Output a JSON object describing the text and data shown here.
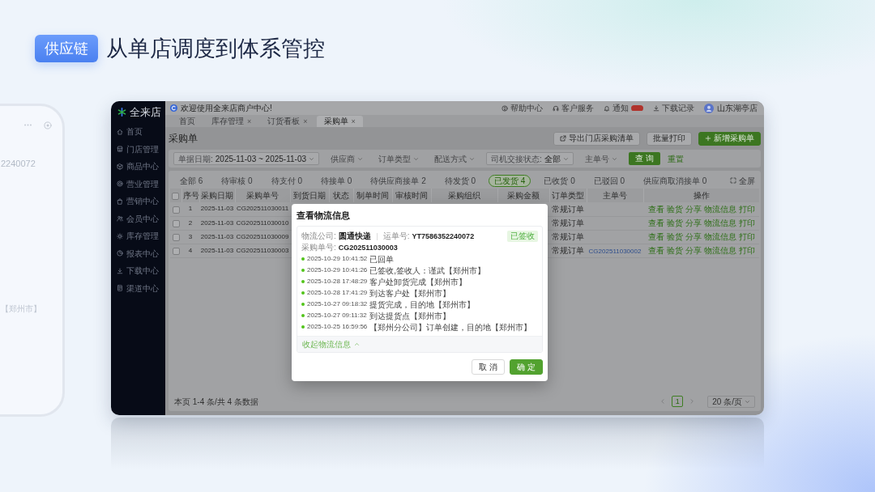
{
  "slide": {
    "tag": "供应链",
    "headline": "从单店调度到体系管控"
  },
  "phone": {
    "texts": [
      "2240072",
      "【郑州市】"
    ]
  },
  "app": {
    "logo": "全来店",
    "sidebar": [
      {
        "label": "首页",
        "selected": false
      },
      {
        "label": "门店管理",
        "selected": false
      },
      {
        "label": "商品中心",
        "selected": false
      },
      {
        "label": "营业管理",
        "selected": false
      },
      {
        "label": "营销中心",
        "selected": false
      },
      {
        "label": "会员中心",
        "selected": false
      },
      {
        "label": "库存管理",
        "selected": false
      },
      {
        "label": "报表中心",
        "selected": false
      },
      {
        "label": "下载中心",
        "selected": false
      },
      {
        "label": "渠道中心",
        "selected": false
      }
    ],
    "topbar": {
      "title": "欢迎使用全来店商户中心!",
      "links": [
        {
          "label": "帮助中心"
        },
        {
          "label": "客户服务"
        },
        {
          "label": "通知",
          "unread": true
        },
        {
          "label": "下载记录"
        }
      ],
      "user": "山东湖亭店"
    },
    "tabs": [
      {
        "label": "首页",
        "selected": false
      },
      {
        "label": "库存管理",
        "close": "×",
        "selected": false
      },
      {
        "label": "订货看板",
        "close": "×",
        "selected": false
      },
      {
        "label": "采购单",
        "close": "×",
        "selected": true
      }
    ],
    "page_title": "采购单",
    "actions": [
      {
        "kind": "export",
        "label": "导出门店采购清单"
      },
      {
        "kind": "print",
        "label": "批量打印"
      },
      {
        "kind": "create",
        "label": "新增采购单"
      }
    ],
    "filters": [
      {
        "label": "单据日期:",
        "value": "2025-11-03 ~ 2025-11-03"
      },
      {
        "placeholder": "供应商"
      },
      {
        "placeholder": "订单类型"
      },
      {
        "placeholder": "配送方式"
      },
      {
        "label": "司机交接状态:",
        "value": "全部"
      },
      {
        "placeholder": "主单号"
      }
    ],
    "search_button": "查 询",
    "reset_link": "重置",
    "status_tabs": [
      {
        "label": "全部 6",
        "selected": false
      },
      {
        "label": "待审核 0",
        "selected": false
      },
      {
        "label": "待支付 0",
        "selected": false
      },
      {
        "label": "待接单 0",
        "selected": false
      },
      {
        "label": "待供应商接单 2",
        "selected": false
      },
      {
        "label": "待发货 0",
        "selected": false
      },
      {
        "label": "已发货 4",
        "selected": true
      },
      {
        "label": "已收货 0",
        "selected": false
      },
      {
        "label": "已驳回 0",
        "selected": false
      },
      {
        "label": "供应商取消接单 0",
        "selected": false
      }
    ],
    "fullscreen": "全屏",
    "table": {
      "columns": [
        {
          "kind": "checkbox",
          "checked": false
        },
        {
          "kind": "text",
          "label": "序号"
        },
        {
          "kind": "text",
          "label": "采购日期"
        },
        {
          "kind": "text",
          "label": "采购单号"
        },
        {
          "kind": "text",
          "label": "到货日期"
        },
        {
          "kind": "text",
          "label": "状态"
        },
        {
          "kind": "text",
          "label": "制单时间"
        },
        {
          "kind": "text",
          "label": "审核时间"
        },
        {
          "kind": "text",
          "label": "采购组织"
        },
        {
          "kind": "text",
          "label": "采购金额"
        },
        {
          "kind": "text",
          "label": "订单类型"
        },
        {
          "kind": "text",
          "label": "主单号"
        },
        {
          "kind": "text",
          "label": "操作"
        }
      ],
      "rows": [
        {
          "checked": false,
          "no": "1",
          "date": "2025-11-03",
          "order_no": "CG202511030011",
          "order_type": "常规订单",
          "actions": [
            "查看",
            "验货",
            "分享",
            "物流信息",
            "打印"
          ]
        },
        {
          "checked": false,
          "no": "2",
          "date": "2025-11-03",
          "order_no": "CG202511030010",
          "order_type": "常规订单",
          "actions": [
            "查看",
            "验货",
            "分享",
            "物流信息",
            "打印"
          ]
        },
        {
          "checked": false,
          "no": "3",
          "date": "2025-11-03",
          "order_no": "CG202511030009",
          "order_type": "常规订单",
          "actions": [
            "查看",
            "验货",
            "分享",
            "物流信息",
            "打印"
          ]
        },
        {
          "checked": false,
          "no": "4",
          "date": "2025-11-03",
          "order_no": "CG202511030003",
          "order_type": "常规订单",
          "main_order_no": "CG202511030002",
          "actions": [
            "查看",
            "验货",
            "分享",
            "物流信息",
            "打印"
          ]
        }
      ]
    },
    "footer": {
      "summary": "本页 1-4 条/共 4 条数据",
      "prev": {
        "disabled": true
      },
      "pages": [
        {
          "label": "1",
          "selected": true
        }
      ],
      "next": {
        "disabled": true
      },
      "page_size": "20 条/页"
    },
    "dialog": {
      "title": "查看物流信息",
      "carrier": {
        "label": "物流公司:",
        "value": "圆通快递"
      },
      "waybill": {
        "label": "运单号:",
        "value": "YT7586352240072"
      },
      "order": {
        "label": "采购单号:",
        "value": "CG202511030003"
      },
      "status": "已签收",
      "events": [
        {
          "time": "2025-10-29 10:41:52",
          "text": "已回单"
        },
        {
          "time": "2025-10-29 10:41:26",
          "text": "已签收,签收人：谨武【郑州市】"
        },
        {
          "time": "2025-10-28 17:48:29",
          "text": "客户处卸货完成【郑州市】"
        },
        {
          "time": "2025-10-28 17:41:29",
          "text": "到达客户处【郑州市】"
        },
        {
          "time": "2025-10-27 09:18:32",
          "text": "提货完成，目的地【郑州市】"
        },
        {
          "time": "2025-10-27 09:11:32",
          "text": "到达提货点【郑州市】"
        },
        {
          "time": "2025-10-25 16:59:56",
          "text": "【郑州分公司】订单创建，目的地【郑州市】"
        }
      ],
      "collapse": "收起物流信息",
      "buttons": [
        {
          "kind": "secondary",
          "label": "取 消"
        },
        {
          "kind": "primary",
          "label": "确 定"
        }
      ]
    }
  }
}
